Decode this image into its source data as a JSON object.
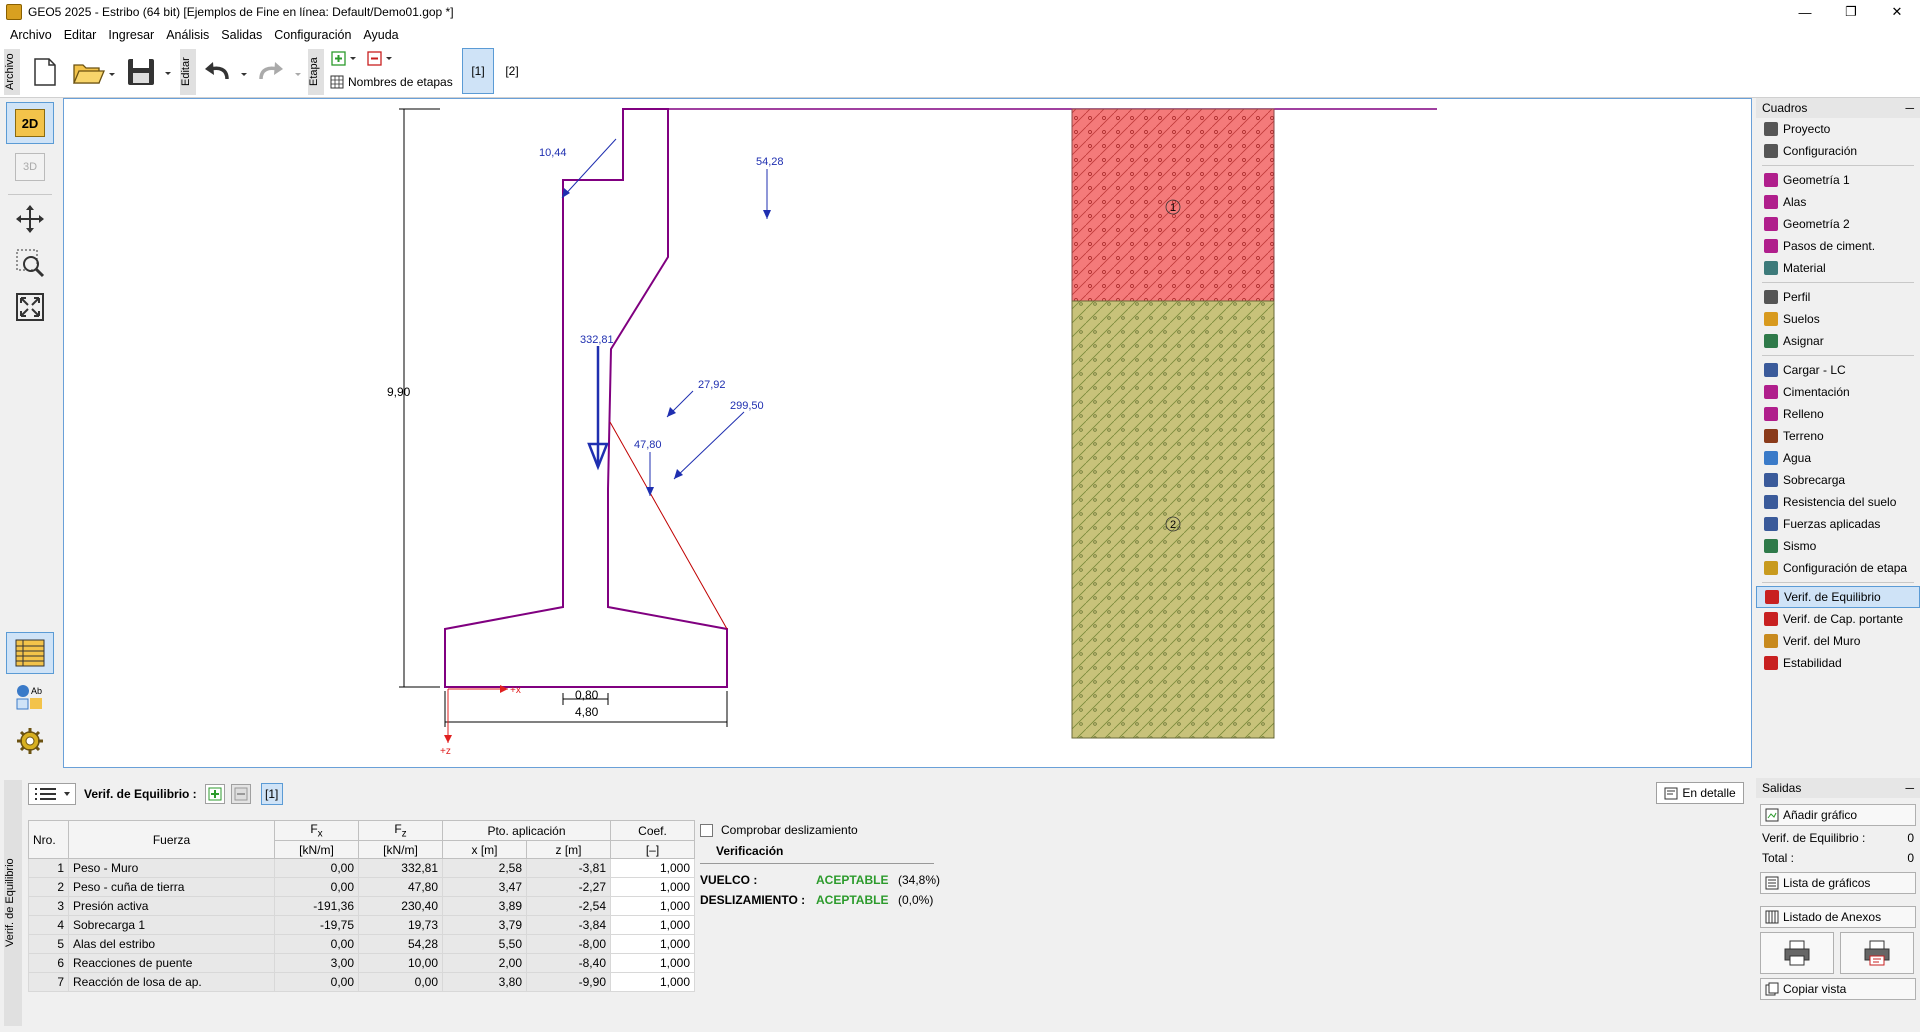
{
  "titlebar": {
    "title": "GEO5 2025 - Estribo (64 bit) [Ejemplos de Fine en línea: Default/Demo01.gop *]"
  },
  "menu": [
    "Archivo",
    "Editar",
    "Ingresar",
    "Análisis",
    "Salidas",
    "Configuración",
    "Ayuda"
  ],
  "toolbar": {
    "archivo_label": "Archivo",
    "editar_label": "Editar",
    "etapa_label": "Etapa",
    "stage_names_label": "Nombres de etapas",
    "stages": [
      "[1]",
      "[2]"
    ],
    "active_stage": "[1]"
  },
  "left_tools": {
    "btn_2d": "2D",
    "btn_3d": "3D"
  },
  "drawing": {
    "dim_height": "9,90",
    "dim_width_small": "0,80",
    "dim_width_base": "4,80",
    "loads": [
      "10,44",
      "54,28",
      "332,81",
      "27,92",
      "299,50",
      "47,80"
    ],
    "axis_x": "+x",
    "axis_z": "+z",
    "soil_labels": [
      "1",
      "2"
    ]
  },
  "cuadros": {
    "title": "Cuadros",
    "groups": [
      [
        {
          "label": "Proyecto",
          "icon": "project-icon",
          "color": "#555555"
        },
        {
          "label": "Configuración",
          "icon": "gear-icon",
          "color": "#555555"
        }
      ],
      [
        {
          "label": "Geometría 1",
          "icon": "geometry-icon",
          "color": "#b01e8c"
        },
        {
          "label": "Alas",
          "icon": "wings-icon",
          "color": "#b01e8c"
        },
        {
          "label": "Geometría 2",
          "icon": "geometry2-icon",
          "color": "#b01e8c"
        },
        {
          "label": "Pasos de ciment.",
          "icon": "footing-steps-icon",
          "color": "#b01e8c"
        },
        {
          "label": "Material",
          "icon": "material-icon",
          "color": "#3d7a7a"
        }
      ],
      [
        {
          "label": "Perfil",
          "icon": "profile-icon",
          "color": "#555555"
        },
        {
          "label": "Suelos",
          "icon": "soils-icon",
          "color": "#d89a1e"
        },
        {
          "label": "Asignar",
          "icon": "assign-icon",
          "color": "#2f7a4a"
        }
      ],
      [
        {
          "label": "Cargar - LC",
          "icon": "load-lc-icon",
          "color": "#3a5a9a"
        },
        {
          "label": "Cimentación",
          "icon": "foundation-icon",
          "color": "#b01e8c"
        },
        {
          "label": "Relleno",
          "icon": "backfill-icon",
          "color": "#b01e8c"
        },
        {
          "label": "Terreno",
          "icon": "terrain-icon",
          "color": "#8a3a1a"
        },
        {
          "label": "Agua",
          "icon": "water-icon",
          "color": "#3a7ac8"
        },
        {
          "label": "Sobrecarga",
          "icon": "surcharge-icon",
          "color": "#3a5a9a"
        },
        {
          "label": "Resistencia del suelo",
          "icon": "soil-resistance-icon",
          "color": "#3a5a9a"
        },
        {
          "label": "Fuerzas aplicadas",
          "icon": "applied-forces-icon",
          "color": "#3a5a9a"
        },
        {
          "label": "Sismo",
          "icon": "earthquake-icon",
          "color": "#2f7a4a"
        },
        {
          "label": "Configuración de etapa",
          "icon": "stage-settings-icon",
          "color": "#c89a1e"
        }
      ],
      [
        {
          "label": "Verif. de Equilibrio",
          "icon": "equilibrium-icon",
          "color": "#c82020",
          "active": true
        },
        {
          "label": "Verif. de Cap. portante",
          "icon": "bearing-capacity-icon",
          "color": "#c82020"
        },
        {
          "label": "Verif. del Muro",
          "icon": "wall-check-icon",
          "color": "#c88a1e"
        },
        {
          "label": "Estabilidad",
          "icon": "stability-icon",
          "color": "#c82020"
        }
      ]
    ]
  },
  "bottom": {
    "side_label": "Verif. de Equilibrio",
    "header_label": "Verif. de Equilibrio :",
    "stage_tag": "[1]",
    "detail_button": "En detalle",
    "table": {
      "headers": {
        "nro": "Nro.",
        "fuerza": "Fuerza",
        "fx": "F",
        "fx_sub": "x",
        "fz": "F",
        "fz_sub": "z",
        "pto": "Pto. aplicación",
        "coef": "Coef.",
        "fx_unit": "[kN/m]",
        "fz_unit": "[kN/m]",
        "x_unit": "x [m]",
        "z_unit": "z [m]",
        "coef_unit": "[–]"
      },
      "rows": [
        {
          "nro": "1",
          "fuerza": "Peso - Muro",
          "fx": "0,00",
          "fz": "332,81",
          "x": "2,58",
          "z": "-3,81",
          "coef": "1,000"
        },
        {
          "nro": "2",
          "fuerza": "Peso - cuña de tierra",
          "fx": "0,00",
          "fz": "47,80",
          "x": "3,47",
          "z": "-2,27",
          "coef": "1,000"
        },
        {
          "nro": "3",
          "fuerza": "Presión activa",
          "fx": "-191,36",
          "fz": "230,40",
          "x": "3,89",
          "z": "-2,54",
          "coef": "1,000"
        },
        {
          "nro": "4",
          "fuerza": "Sobrecarga 1",
          "fx": "-19,75",
          "fz": "19,73",
          "x": "3,79",
          "z": "-3,84",
          "coef": "1,000"
        },
        {
          "nro": "5",
          "fuerza": "Alas del estribo",
          "fx": "0,00",
          "fz": "54,28",
          "x": "5,50",
          "z": "-8,00",
          "coef": "1,000"
        },
        {
          "nro": "6",
          "fuerza": "Reacciones de puente",
          "fx": "3,00",
          "fz": "10,00",
          "x": "2,00",
          "z": "-8,40",
          "coef": "1,000"
        },
        {
          "nro": "7",
          "fuerza": "Reacción de losa de ap.",
          "fx": "0,00",
          "fz": "0,00",
          "x": "3,80",
          "z": "-9,90",
          "coef": "1,000"
        }
      ]
    },
    "check_sliding": "Comprobar deslizamiento",
    "verification_title": "Verificación",
    "overturn_label": "VUELCO :",
    "overturn_status": "ACEPTABLE",
    "overturn_value": "(34,8%)",
    "sliding_label": "DESLIZAMIENTO :",
    "sliding_status": "ACEPTABLE",
    "sliding_value": "(0,0%)"
  },
  "salidas": {
    "title": "Salidas",
    "add_graphic": "Añadir gráfico",
    "verif_label": "Verif. de Equilibrio :",
    "verif_count": "0",
    "total_label": "Total :",
    "total_count": "0",
    "graphics_list": "Lista de gráficos",
    "annex_list": "Listado de Anexos",
    "copy_view": "Copiar vista"
  }
}
